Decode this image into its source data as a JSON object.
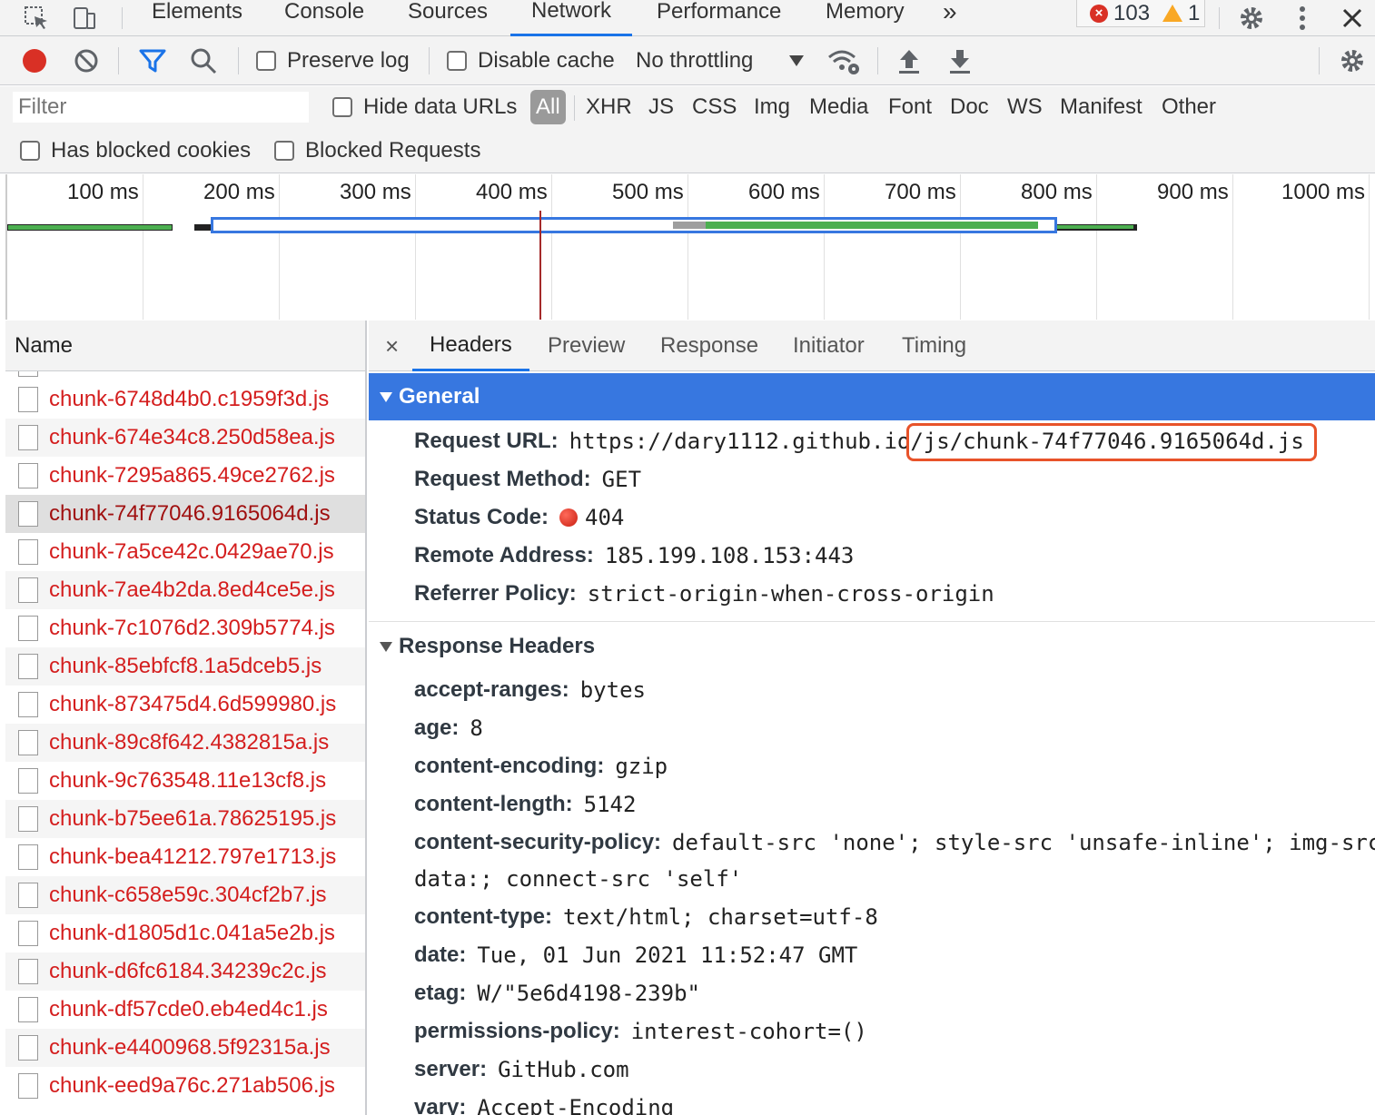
{
  "devtools": {
    "tabs": [
      "Elements",
      "Console",
      "Sources",
      "Network",
      "Performance",
      "Memory"
    ],
    "active_tab": "Network",
    "more_tabs_label": "»",
    "error_count": "103",
    "warning_count": "1"
  },
  "toolbar": {
    "preserve_log": "Preserve log",
    "disable_cache": "Disable cache",
    "throttling": "No throttling"
  },
  "filter": {
    "placeholder": "Filter",
    "hide_data_urls": "Hide data URLs",
    "types": [
      "All",
      "XHR",
      "JS",
      "CSS",
      "Img",
      "Media",
      "Font",
      "Doc",
      "WS",
      "Manifest",
      "Other"
    ],
    "has_blocked_cookies": "Has blocked cookies",
    "blocked_requests": "Blocked Requests"
  },
  "timeline": {
    "ticks": [
      "100 ms",
      "200 ms",
      "300 ms",
      "400 ms",
      "500 ms",
      "600 ms",
      "700 ms",
      "800 ms",
      "900 ms",
      "1000 ms"
    ]
  },
  "list": {
    "header": "Name",
    "items": [
      "chunk-6748d4b0.c1959f3d.js",
      "chunk-674e34c8.250d58ea.js",
      "chunk-7295a865.49ce2762.js",
      "chunk-74f77046.9165064d.js",
      "chunk-7a5ce42c.0429ae70.js",
      "chunk-7ae4b2da.8ed4ce5e.js",
      "chunk-7c1076d2.309b5774.js",
      "chunk-85ebfcf8.1a5dceb5.js",
      "chunk-873475d4.6d599980.js",
      "chunk-89c8f642.4382815a.js",
      "chunk-9c763548.11e13cf8.js",
      "chunk-b75ee61a.78625195.js",
      "chunk-bea41212.797e1713.js",
      "chunk-c658e59c.304cf2b7.js",
      "chunk-d1805d1c.041a5e2b.js",
      "chunk-d6fc6184.34239c2c.js",
      "chunk-df57cde0.eb4ed4c1.js",
      "chunk-e4400968.5f92315a.js",
      "chunk-eed9a76c.271ab506.js"
    ]
  },
  "detail": {
    "close": "×",
    "tabs": [
      "Headers",
      "Preview",
      "Response",
      "Initiator",
      "Timing"
    ],
    "general": {
      "title": "General",
      "request_url_k": "Request URL:",
      "request_url_v": "https://dary1112.github.io/js/chunk-74f77046.9165064d.js",
      "request_method_k": "Request Method:",
      "request_method_v": "GET",
      "status_code_k": "Status Code:",
      "status_code_v": "404",
      "remote_address_k": "Remote Address:",
      "remote_address_v": "185.199.108.153:443",
      "referrer_policy_k": "Referrer Policy:",
      "referrer_policy_v": "strict-origin-when-cross-origin"
    },
    "response_headers": {
      "title": "Response Headers",
      "accept_ranges_k": "accept-ranges:",
      "accept_ranges_v": "bytes",
      "age_k": "age:",
      "age_v": "8",
      "content_encoding_k": "content-encoding:",
      "content_encoding_v": "gzip",
      "content_length_k": "content-length:",
      "content_length_v": "5142",
      "csp_k": "content-security-policy:",
      "csp_v1": "default-src 'none'; style-src 'unsafe-inline'; img-src",
      "csp_v2": "data:; connect-src 'self'",
      "content_type_k": "content-type:",
      "content_type_v": "text/html; charset=utf-8",
      "date_k": "date:",
      "date_v": "Tue, 01 Jun 2021 11:52:47 GMT",
      "etag_k": "etag:",
      "etag_v": "W/\"5e6d4198-239b\"",
      "permissions_policy_k": "permissions-policy:",
      "permissions_policy_v": "interest-cohort=()",
      "server_k": "server:",
      "server_v": "GitHub.com",
      "vary_k": "vary:",
      "vary_v": "Accept-Encoding"
    }
  }
}
